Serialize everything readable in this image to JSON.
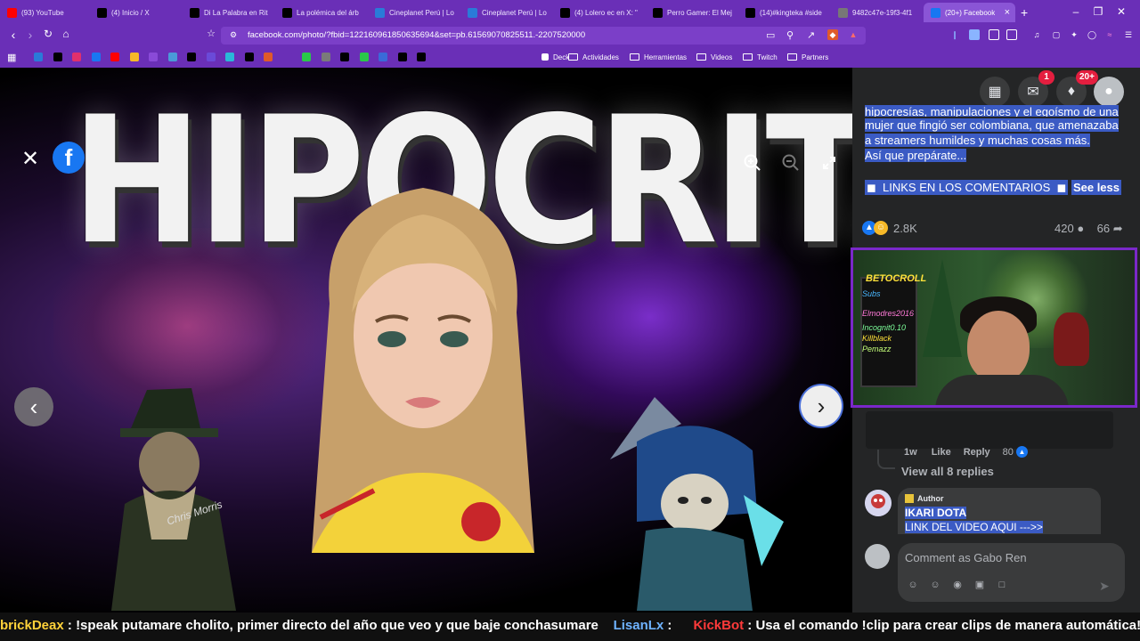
{
  "browser": {
    "tabs": [
      {
        "label": "(93) YouTube",
        "icon": "youtube-icon",
        "color": "#ff0000"
      },
      {
        "label": "(4) Inicio / X",
        "icon": "x-icon",
        "color": "#000000"
      },
      {
        "label": "Di La Palabra en Rit",
        "icon": "tiktok-icon",
        "color": "#000000"
      },
      {
        "label": "La polémica del árb",
        "icon": "tiktok-icon",
        "color": "#000000"
      },
      {
        "label": "Cineplanet Perú | Lo",
        "icon": "globe-icon",
        "color": "#2a7bd8"
      },
      {
        "label": "Cineplanet Perú | Lo",
        "icon": "globe-icon",
        "color": "#2a7bd8"
      },
      {
        "label": "(4) Lolero ec en X: \"",
        "icon": "x-icon",
        "color": "#000000"
      },
      {
        "label": "Perro Gamer: El Mej",
        "icon": "tiktok-icon",
        "color": "#000000"
      },
      {
        "label": "(14)#kingteka #side",
        "icon": "tiktok-icon",
        "color": "#000000"
      },
      {
        "label": "9482c47e-19f3-4f1",
        "icon": "globe-icon",
        "color": "#777777"
      },
      {
        "label": "(20+) Facebook",
        "icon": "facebook-icon",
        "color": "#1877f2",
        "active": true
      }
    ],
    "url": "facebook.com/photo/?fbid=122160961850635694&set=pb.61569070825511.-2207520000",
    "bookmarks": {
      "folders": [
        "Deck",
        "Actividades",
        "Herramientas",
        "Videos",
        "Twitch",
        "Partners"
      ]
    }
  },
  "viewer": {
    "image_title_text": "HIPOCRITA",
    "watermark": "Chris Morris",
    "facebook_logo": "f"
  },
  "post": {
    "cut_line": "hipocresías, manipulaciones y el egoísmo de una",
    "text_lines": [
      "mujer que fingió ser colombiana, que amenazaba",
      "a streamers humildes y muchas cosas más.",
      "Así que prepárate..."
    ],
    "links_text": "LINKS EN LOS COMENTARIOS",
    "see_less": "See less",
    "reactions_count": "2.8K",
    "comments_count": "420",
    "shares_count": "66"
  },
  "header": {
    "messenger_badge": "1",
    "notifications_badge": "20+"
  },
  "stream_overlay": {
    "channel_name": "BETOCROLL",
    "board_lines": [
      "Subs",
      "Elmodres2016",
      "Incognit0.10",
      "Killblack",
      "Pemazz"
    ]
  },
  "comments": {
    "reply_time": "1w",
    "like_label": "Like",
    "reply_label": "Reply",
    "reply_like_count": "80",
    "view_replies": "View all 8 replies",
    "author_badge": "Author",
    "author_name": "IKARI DOTA",
    "author_text": "LINK DEL VIDEO AQUI --->>",
    "input_placeholder": "Comment as Gabo Ren"
  },
  "chat": {
    "user1": "brickDeax",
    "msg1": "!speak putamare cholito, primer directo del año que veo y que baje conchasumare",
    "user2": "LisanLx",
    "user3": "KickBot",
    "msg3": "Usa el comando !clip para crear clips de manera automática!"
  }
}
